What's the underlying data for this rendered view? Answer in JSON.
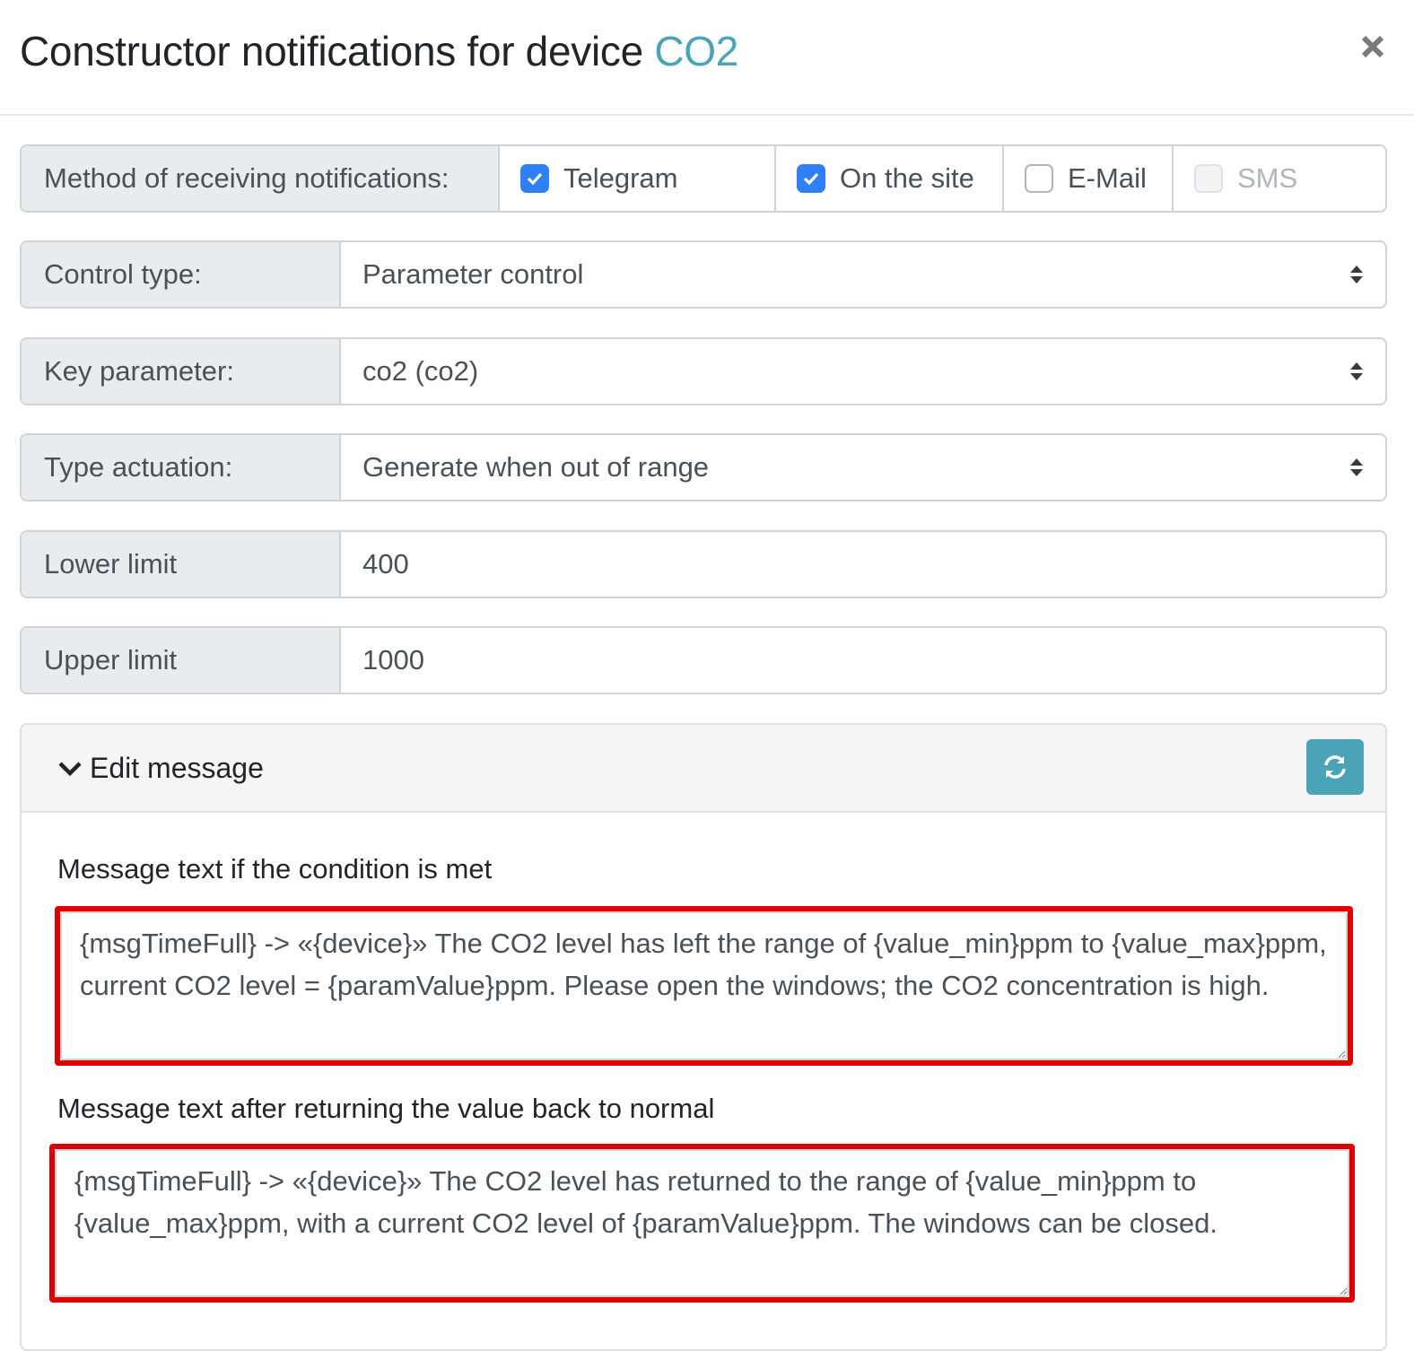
{
  "header": {
    "title_prefix": "Constructor notifications for device",
    "device_name": "CO2",
    "close_icon": "close-icon"
  },
  "method": {
    "label": "Method of receiving notifications:",
    "options": [
      {
        "label": "Telegram",
        "checked": true,
        "disabled": false
      },
      {
        "label": "On the site",
        "checked": true,
        "disabled": false
      },
      {
        "label": "E-Mail",
        "checked": false,
        "disabled": false
      },
      {
        "label": "SMS",
        "checked": false,
        "disabled": true
      }
    ]
  },
  "control_type": {
    "label": "Control type:",
    "value": "Parameter control"
  },
  "key_parameter": {
    "label": "Key parameter:",
    "value": "co2 (co2)"
  },
  "type_actuation": {
    "label": "Type actuation:",
    "value": "Generate when out of range"
  },
  "lower_limit": {
    "label": "Lower limit",
    "value": "400"
  },
  "upper_limit": {
    "label": "Upper limit",
    "value": "1000"
  },
  "edit_message": {
    "toggle_label": "Edit message",
    "toggle_icon": "chevron-down-icon",
    "refresh_icon": "refresh-icon",
    "condition_met_label": "Message text if the condition is met",
    "condition_met_text": "{msgTimeFull} -> «{device}» The CO2 level has left the range of {value_min}ppm to {value_max}ppm, current CO2 level = {paramValue}ppm. Please open the windows; the CO2 concentration is high.",
    "back_to_normal_label": "Message text after returning the value back to normal",
    "back_to_normal_text": "{msgTimeFull} -> «{device}» The CO2 level has returned to the range of {value_min}ppm to {value_max}ppm, with a current CO2 level of {paramValue}ppm. The windows can be closed."
  },
  "colors": {
    "accent": "#4aa3b7",
    "checkbox_checked": "#2f80f6",
    "highlight_border": "#e00000"
  }
}
